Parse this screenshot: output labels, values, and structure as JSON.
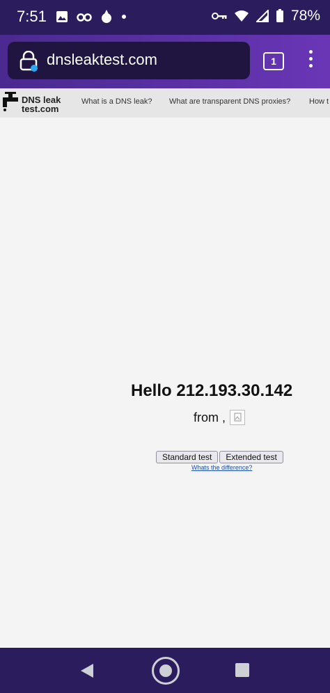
{
  "status_bar": {
    "time": "7:51",
    "battery": "78%",
    "left_icons": [
      "image-icon",
      "incognito-icon",
      "fire-app-icon",
      "dot-icon"
    ],
    "right_icons": [
      "vpn-key-icon",
      "wifi-icon",
      "signal-icon",
      "battery-icon"
    ]
  },
  "browser": {
    "url": "dnsleaktest.com",
    "tab_count": "1"
  },
  "site_nav": {
    "logo_line1": "DNS leak",
    "logo_line2": "test.com",
    "links": [
      "What is a DNS leak?",
      "What are transparent DNS proxies?",
      "How t"
    ]
  },
  "main": {
    "hello": "Hello 212.193.30.142",
    "from": "from ,",
    "standard_button": "Standard test",
    "extended_button": "Extended test",
    "difference_link": "Whats the difference?"
  },
  "colors": {
    "status_bar": "#2b1c5e",
    "toolbar": "#5b31a6",
    "urlbar": "#1f1540",
    "page_bg": "#f4f4f4",
    "nav_bg": "#e6e6e6"
  }
}
